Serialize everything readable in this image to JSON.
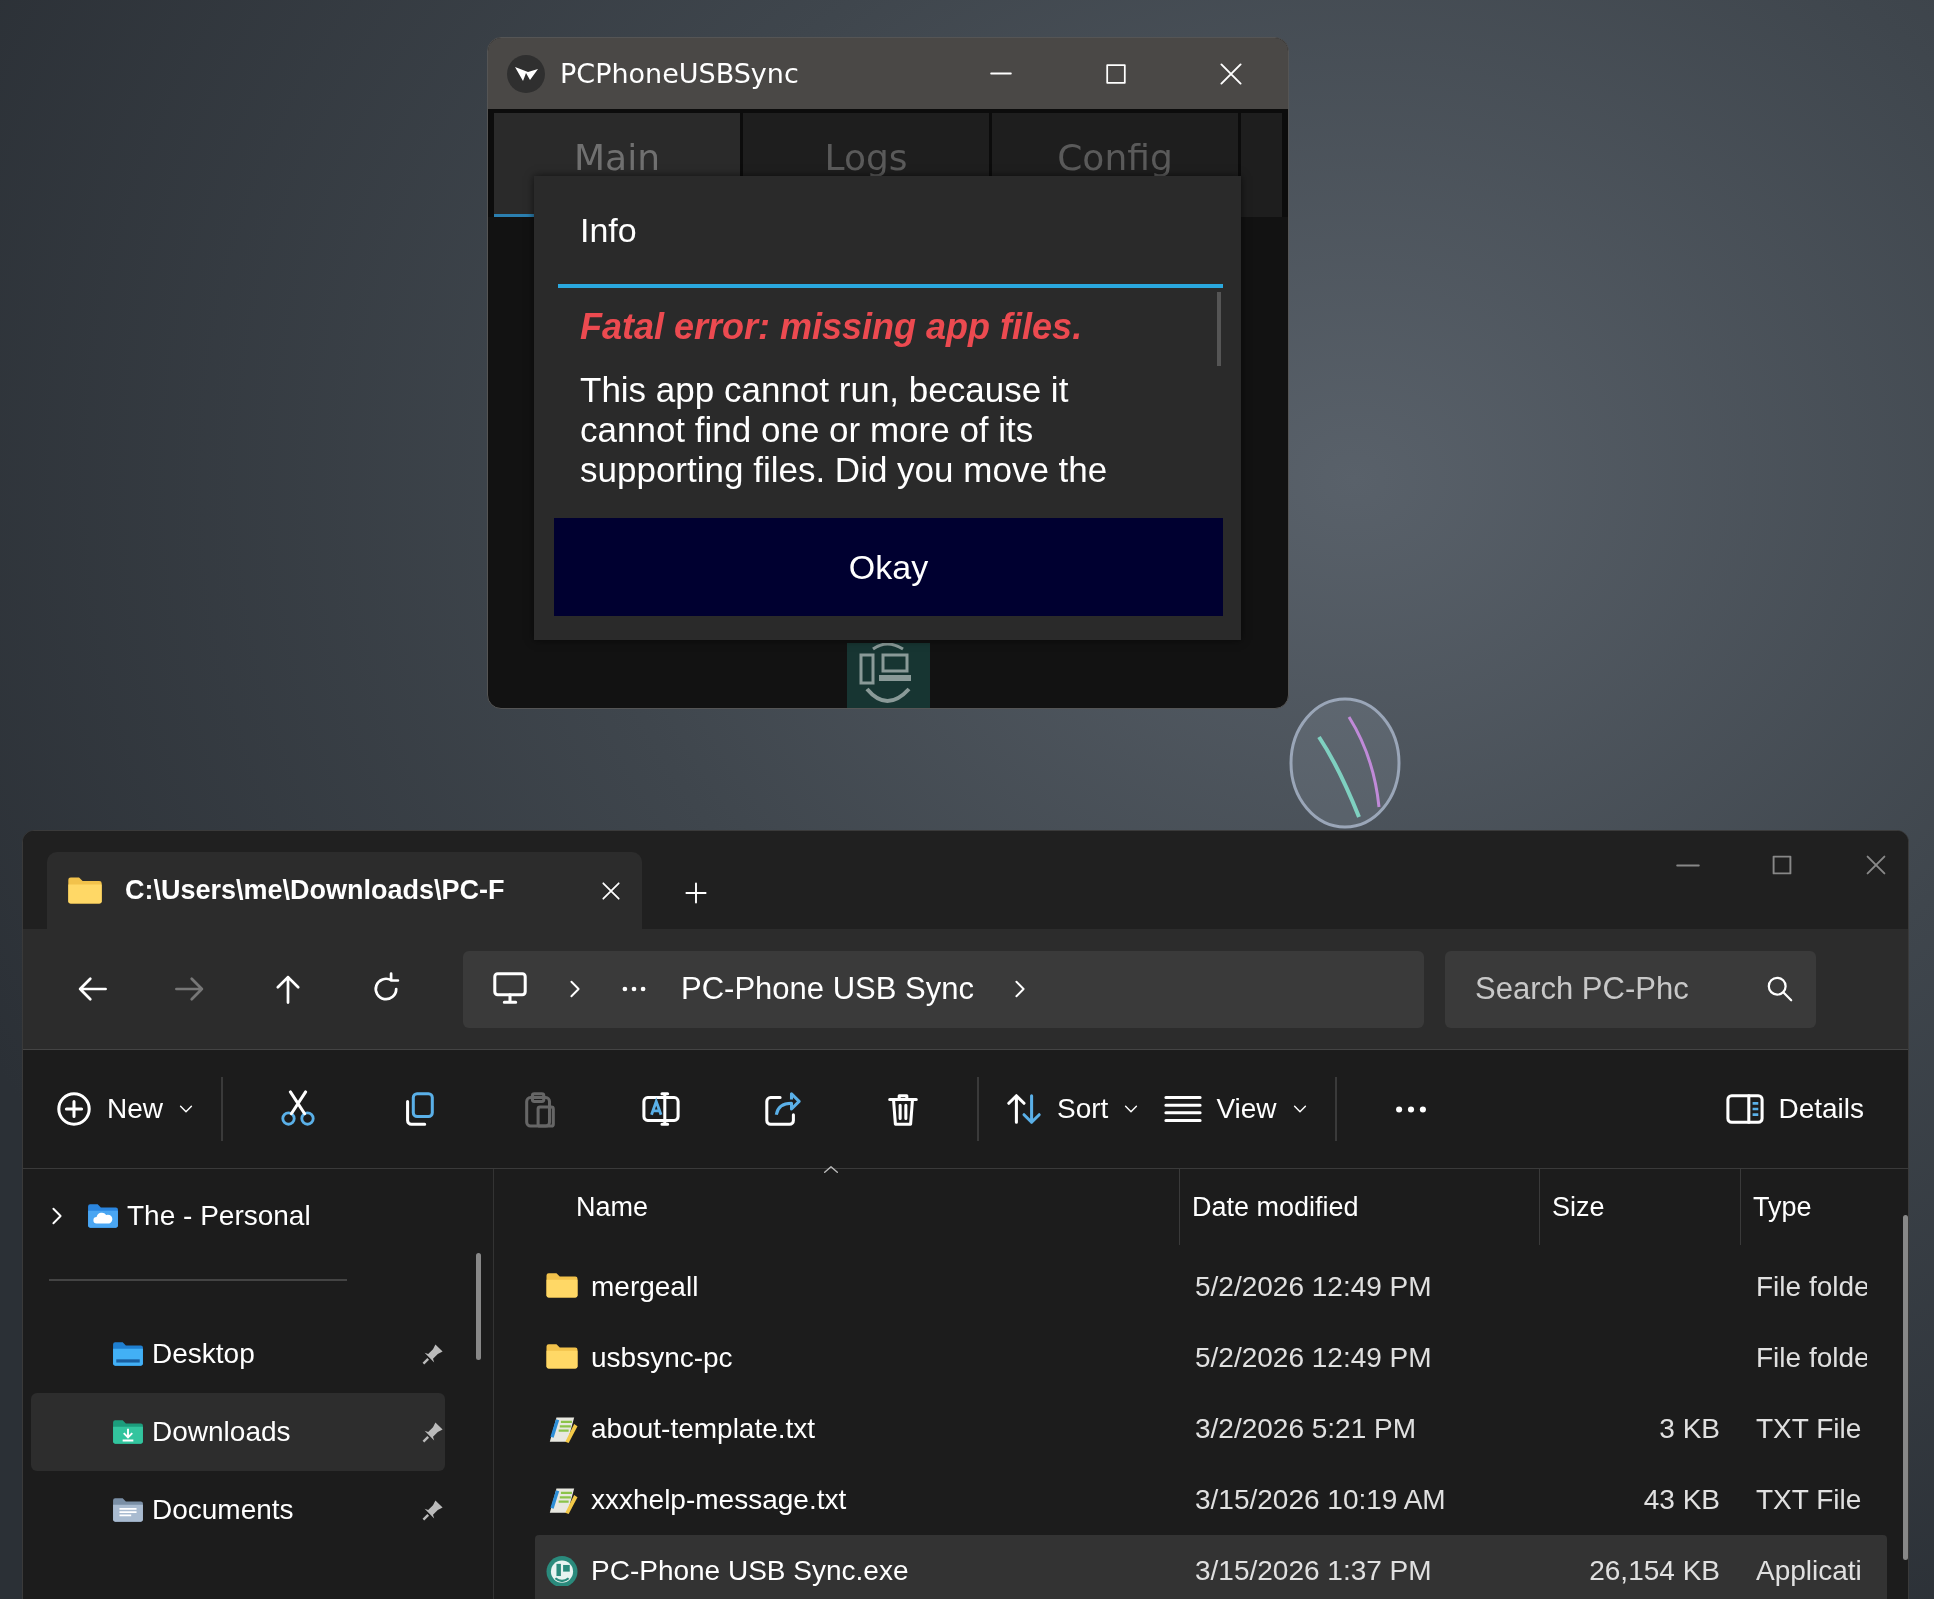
{
  "app_window": {
    "title": "PCPhoneUSBSync",
    "tabs": [
      {
        "label": "Main",
        "selected": true
      },
      {
        "label": "Logs",
        "selected": false
      },
      {
        "label": "Config",
        "selected": false
      }
    ]
  },
  "dialog": {
    "title": "Info",
    "error": "Fatal error: missing app files.",
    "message": "This app cannot run, because it cannot find one or more of its supporting files.  Did you move the",
    "button": "Okay"
  },
  "explorer": {
    "tabs": [
      {
        "label": "C:\\Users\\me\\Downloads\\PC-F",
        "selected": true
      }
    ],
    "nav": [
      {
        "kind": "back",
        "disabled": false
      },
      {
        "kind": "forward",
        "disabled": true
      },
      {
        "kind": "up",
        "disabled": false
      },
      {
        "kind": "refresh",
        "disabled": false
      }
    ],
    "breadcrumb": "PC-Phone USB Sync",
    "search": {
      "placeholder": "Search PC-Phc"
    },
    "toolbar": [
      {
        "kind": "new",
        "label": "New",
        "disabled": false
      },
      {
        "kind": "cut",
        "disabled": false
      },
      {
        "kind": "copy",
        "disabled": false
      },
      {
        "kind": "paste",
        "disabled": true
      },
      {
        "kind": "rename",
        "disabled": false
      },
      {
        "kind": "share",
        "disabled": false
      },
      {
        "kind": "delete",
        "disabled": false
      },
      {
        "kind": "sort",
        "label": "Sort",
        "disabled": false
      },
      {
        "kind": "view",
        "label": "View",
        "disabled": false
      },
      {
        "kind": "more",
        "disabled": false
      },
      {
        "kind": "details",
        "label": "Details",
        "disabled": false
      }
    ],
    "sidebar": {
      "items": [
        {
          "kind": "cloud",
          "label": "The - Personal",
          "pinned": false,
          "selected": false
        },
        {
          "kind": "desktop",
          "label": "Desktop",
          "pinned": true,
          "selected": false
        },
        {
          "kind": "downloads",
          "label": "Downloads",
          "pinned": true,
          "selected": true
        },
        {
          "kind": "documents",
          "label": "Documents",
          "pinned": true,
          "selected": false
        }
      ]
    },
    "table": {
      "columns": [
        {
          "label": "Name",
          "sorted": true
        },
        {
          "label": "Date modified",
          "sorted": false
        },
        {
          "label": "Size",
          "sorted": false
        },
        {
          "label": "Type",
          "sorted": false
        }
      ],
      "rows": [
        {
          "kind": "folder",
          "name": "mergeall",
          "date": "5/2/2026 12:49 PM",
          "size": "",
          "type": "File folde",
          "selected": false
        },
        {
          "kind": "folder",
          "name": "usbsync-pc",
          "date": "5/2/2026 12:49 PM",
          "size": "",
          "type": "File folde",
          "selected": false
        },
        {
          "kind": "text",
          "name": "about-template.txt",
          "date": "3/2/2026 5:21 PM",
          "size": "3 KB",
          "type": "TXT File",
          "selected": false
        },
        {
          "kind": "text",
          "name": "xxxhelp-message.txt",
          "date": "3/15/2026 10:19 AM",
          "size": "43 KB",
          "type": "TXT File",
          "selected": false
        },
        {
          "kind": "app",
          "name": "PC-Phone USB Sync.exe",
          "date": "3/15/2026 1:37 PM",
          "size": "26,154 KB",
          "type": "Applicati",
          "selected": true
        }
      ]
    }
  }
}
